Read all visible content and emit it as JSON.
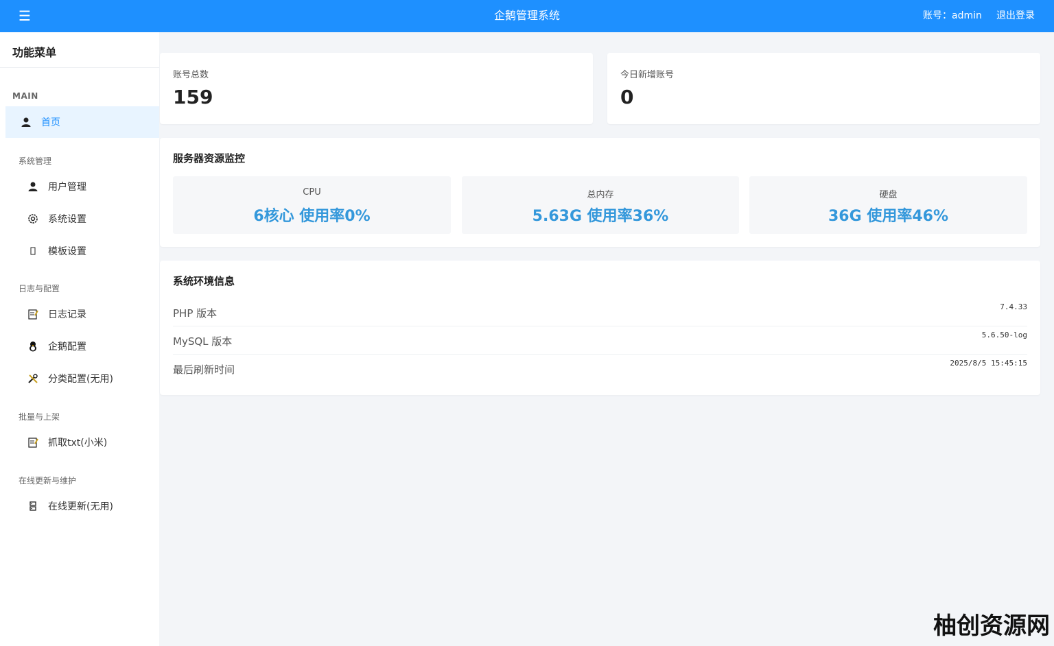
{
  "topbar": {
    "menu_icon": "☰",
    "title": "企鹅管理系统",
    "account": "账号：admin",
    "logout": "退出登录"
  },
  "sidebar": {
    "header": "功能菜单",
    "main_label": "MAIN",
    "home": {
      "icon": "user-icon",
      "label": "首页"
    },
    "sections": [
      {
        "label": "系统管理",
        "items": [
          {
            "icon": "user-icon",
            "label": "用户管理"
          },
          {
            "icon": "gear-icon",
            "label": "系统设置"
          },
          {
            "icon": "template-icon",
            "label": "模板设置"
          }
        ]
      },
      {
        "label": "日志与配置",
        "items": [
          {
            "icon": "log-icon",
            "label": "日志记录"
          },
          {
            "icon": "penguin-icon",
            "label": "企鹅配置"
          },
          {
            "icon": "tools-icon",
            "label": "分类配置(无用)"
          }
        ]
      },
      {
        "label": "批量与上架",
        "items": [
          {
            "icon": "log-icon",
            "label": "抓取txt(小米)"
          }
        ]
      },
      {
        "label": "在线更新与维护",
        "items": [
          {
            "icon": "update-icon",
            "label": "在线更新(无用)"
          }
        ]
      }
    ]
  },
  "stats": {
    "total_label": "账号总数",
    "total_value": "159",
    "today_label": "今日新增账号",
    "today_value": "0"
  },
  "resources": {
    "title": "服务器资源监控",
    "cpu": {
      "name": "CPU",
      "value": "6核心 使用率0%"
    },
    "memory": {
      "name": "总内存",
      "value": "5.63G 使用率36%"
    },
    "disk": {
      "name": "硬盘",
      "value": "36G 使用率46%"
    }
  },
  "env": {
    "title": "系统环境信息",
    "rows": [
      {
        "key": "PHP 版本",
        "value": "7.4.33"
      },
      {
        "key": "MySQL 版本",
        "value": "5.6.50-log"
      },
      {
        "key": "最后刷新时间",
        "value": "2025/8/5 15:45:15"
      }
    ]
  },
  "watermark": "柚创资源网",
  "colors": {
    "accent": "#1e90ff",
    "value_blue": "#3498db",
    "active_bg": "#e8f4ff"
  }
}
